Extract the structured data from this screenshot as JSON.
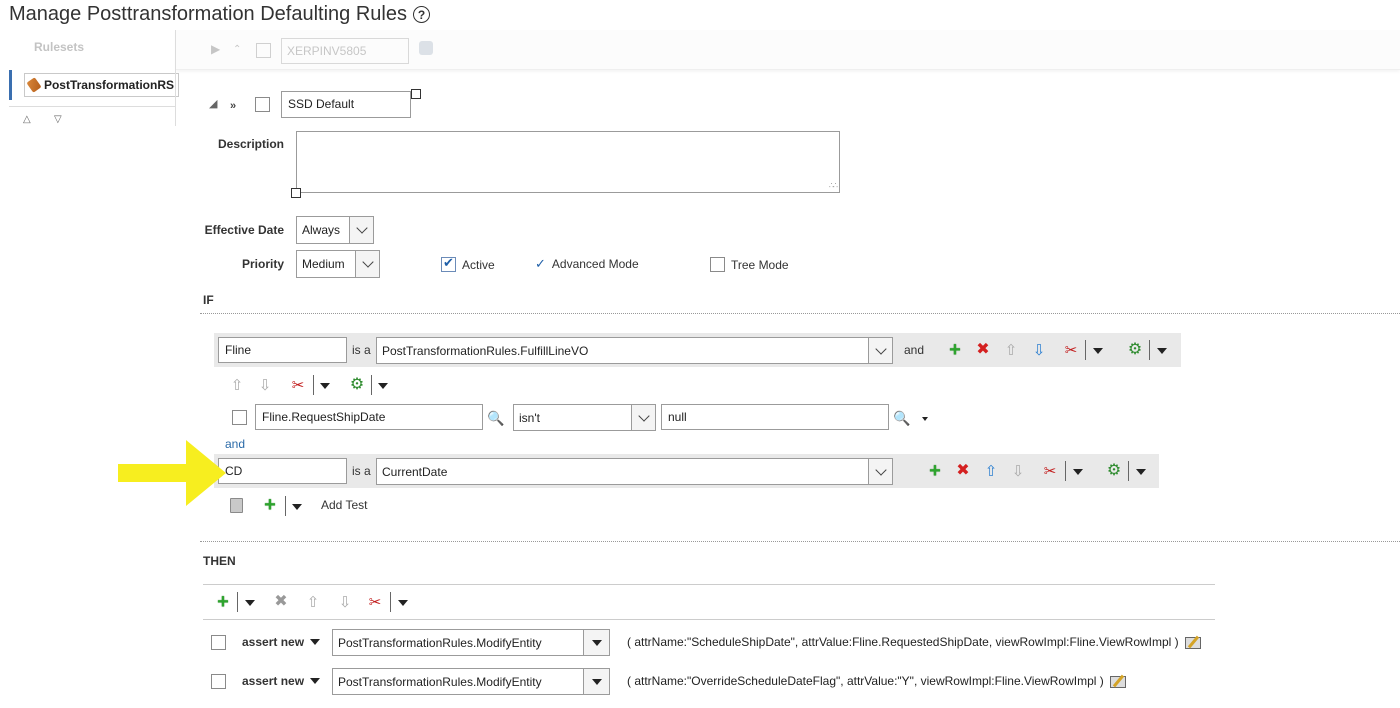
{
  "page": {
    "title": "Manage Posttransformation Defaulting Rules"
  },
  "ghost_header": {
    "input_value": "XERPINV5805"
  },
  "rulesets": {
    "header": "Rulesets",
    "items": [
      {
        "label": "PostTransformationRS"
      }
    ]
  },
  "rule": {
    "name": "SSD Default",
    "description_label": "Description",
    "description_value": "",
    "effective_date_label": "Effective Date",
    "effective_date_value": "Always",
    "priority_label": "Priority",
    "priority_value": "Medium",
    "active_label": "Active",
    "active_checked": true,
    "advanced_mode_label": "Advanced Mode",
    "tree_mode_label": "Tree Mode",
    "tree_mode_checked": false
  },
  "if_section": {
    "label": "IF",
    "patterns": [
      {
        "alias": "Fline",
        "is_a": "is a",
        "fact_type": "PostTransformationRules.FulfillLineVO",
        "conjunction": "and"
      },
      {
        "alias": "CD",
        "is_a": "is a",
        "fact_type": "CurrentDate"
      }
    ],
    "test": {
      "left": "Fline.RequestShipDate",
      "operator": "isn't",
      "right": "null"
    },
    "and_link": "and",
    "add_test_label": "Add Test"
  },
  "then_section": {
    "label": "THEN",
    "actions": [
      {
        "verb": "assert new",
        "target": "PostTransformationRules.ModifyEntity",
        "params": "( attrName:\"ScheduleShipDate\", attrValue:Fline.RequestedShipDate, viewRowImpl:Fline.ViewRowImpl )"
      },
      {
        "verb": "assert new",
        "target": "PostTransformationRules.ModifyEntity",
        "params": "( attrName:\"OverrideScheduleDateFlag\", attrValue:\"Y\", viewRowImpl:Fline.ViewRowImpl )"
      }
    ]
  },
  "colors": {
    "annotation_arrow": "#f7ee1f",
    "add_green": "#2ea42e",
    "delete_red": "#d42020",
    "move_blue": "#2c7fd0",
    "link_blue": "#2a6aa8"
  }
}
